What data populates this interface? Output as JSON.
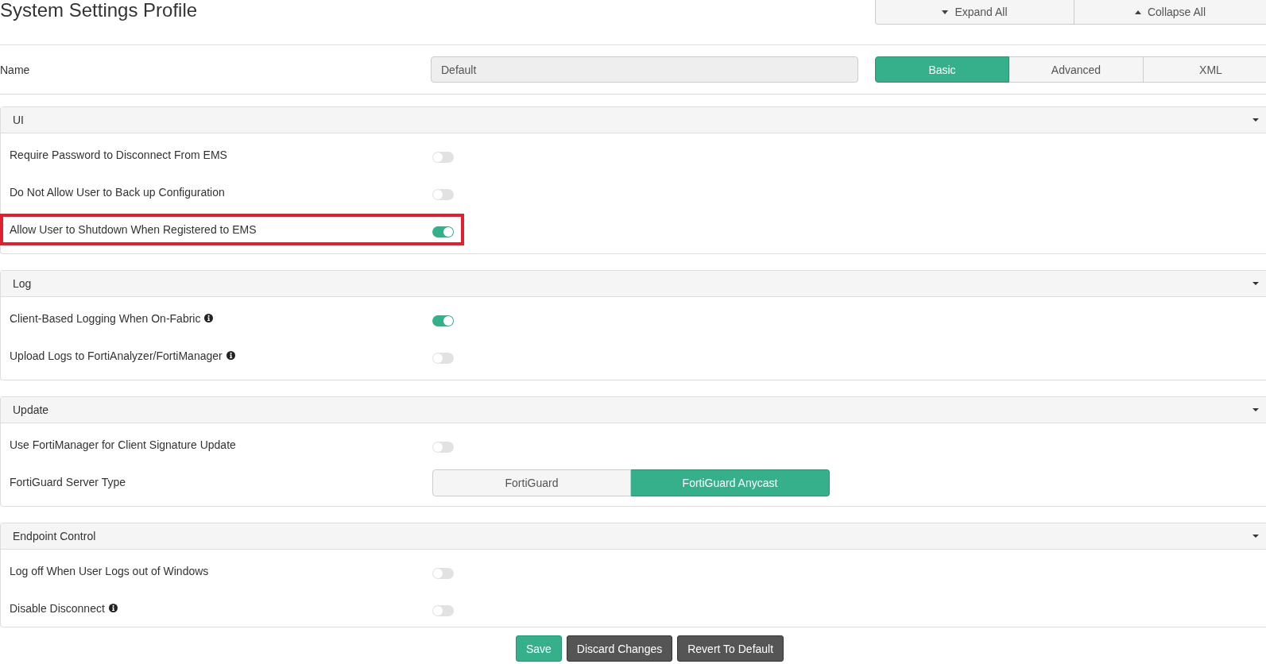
{
  "header": {
    "title": "System Settings Profile",
    "buttons": [
      {
        "kind": "expand",
        "label": "Expand All"
      },
      {
        "kind": "collapse",
        "label": "Collapse All"
      }
    ]
  },
  "name_row": {
    "label": "Name",
    "value": "Default",
    "disabled": true
  },
  "mode_tabs": [
    {
      "label": "Basic",
      "selected": true
    },
    {
      "label": "Advanced",
      "selected": false
    },
    {
      "label": "XML",
      "selected": false
    }
  ],
  "sections": [
    {
      "title": "UI",
      "expanded": true,
      "settings": [
        {
          "kind": "toggle",
          "label": "Require Password to Disconnect From EMS",
          "info": false,
          "highlighted": false,
          "on": false
        },
        {
          "kind": "toggle",
          "label": "Do Not Allow User to Back up Configuration",
          "info": false,
          "highlighted": false,
          "on": false
        },
        {
          "kind": "toggle",
          "label": "Allow User to Shutdown When Registered to EMS",
          "info": false,
          "highlighted": true,
          "on": true
        }
      ]
    },
    {
      "title": "Log",
      "expanded": true,
      "settings": [
        {
          "kind": "toggle",
          "label": "Client-Based Logging When On-Fabric",
          "info": true,
          "highlighted": false,
          "on": true
        },
        {
          "kind": "toggle",
          "label": "Upload Logs to FortiAnalyzer/FortiManager",
          "info": true,
          "highlighted": false,
          "on": false
        }
      ]
    },
    {
      "title": "Update",
      "expanded": true,
      "settings": [
        {
          "kind": "toggle",
          "label": "Use FortiManager for Client Signature Update",
          "info": false,
          "highlighted": false,
          "on": false
        },
        {
          "kind": "choice",
          "label": "FortiGuard Server Type",
          "info": false,
          "highlighted": false,
          "options": [
            {
              "label": "FortiGuard",
              "selected": false
            },
            {
              "label": "FortiGuard Anycast",
              "selected": true
            }
          ]
        }
      ]
    },
    {
      "title": "Endpoint Control",
      "expanded": true,
      "settings": [
        {
          "kind": "toggle",
          "label": "Log off When User Logs out of Windows",
          "info": false,
          "highlighted": false,
          "on": false
        },
        {
          "kind": "toggle",
          "label": "Disable Disconnect",
          "info": true,
          "highlighted": false,
          "on": false
        }
      ]
    }
  ],
  "actions": [
    {
      "kind": "primary",
      "label": "Save"
    },
    {
      "kind": "dark",
      "label": "Discard Changes"
    },
    {
      "kind": "dark",
      "label": "Revert To Default"
    }
  ]
}
